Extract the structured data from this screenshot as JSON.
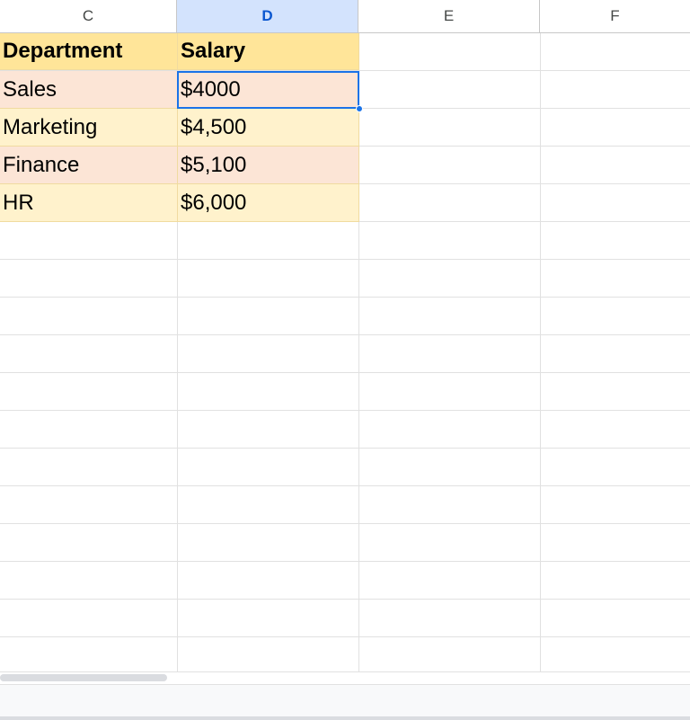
{
  "columns": [
    "C",
    "D",
    "E",
    "F"
  ],
  "selected_column": "D",
  "table": {
    "headers": [
      "Department",
      "Salary"
    ],
    "rows": [
      [
        "Sales",
        "$4000"
      ],
      [
        "Marketing",
        "$4,500"
      ],
      [
        "Finance",
        "$5,100"
      ],
      [
        "HR",
        "$6,000"
      ]
    ]
  },
  "active_cell": "D2",
  "colors": {
    "header_fill": "#ffe599",
    "row_peach": "#fce5d6",
    "row_cream": "#fff2cc",
    "selection_blue": "#1a73e8",
    "selected_header_fill": "#d3e3fd"
  }
}
